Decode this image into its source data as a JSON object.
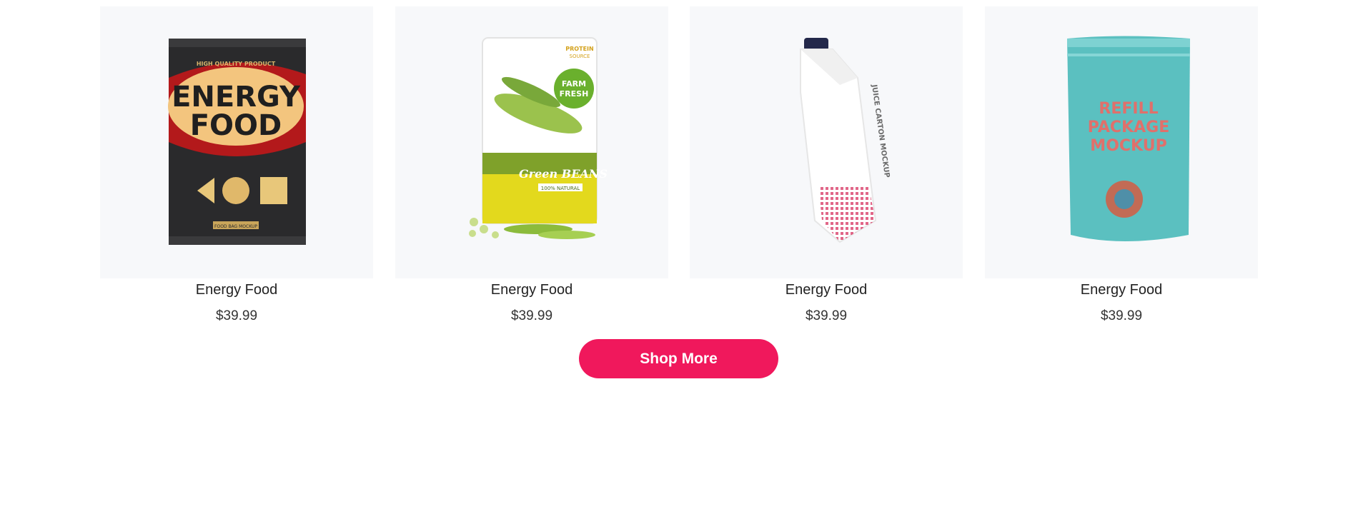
{
  "products": [
    {
      "name": "Energy Food",
      "price": "$39.99",
      "image": "energy-food-bag",
      "pack_text": [
        "HIGH QUALITY PRODUCT",
        "ENERGY",
        "FOOD",
        "FOOD BAG MOCKUP"
      ]
    },
    {
      "name": "Energy Food",
      "price": "$39.99",
      "image": "green-beans-pouch",
      "pack_text": [
        "PROTEIN",
        "SOURCE",
        "FARM",
        "FRESH",
        "Green BEANS",
        "100% NATURAL"
      ]
    },
    {
      "name": "Energy Food",
      "price": "$39.99",
      "image": "juice-carton",
      "pack_text": [
        "JUICE CARTON MOCKUP"
      ]
    },
    {
      "name": "Energy Food",
      "price": "$39.99",
      "image": "refill-pouch",
      "pack_text": [
        "REFILL",
        "PACKAGE",
        "MOCKUP"
      ]
    }
  ],
  "cta": {
    "label": "Shop More",
    "color": "#f0185c"
  }
}
